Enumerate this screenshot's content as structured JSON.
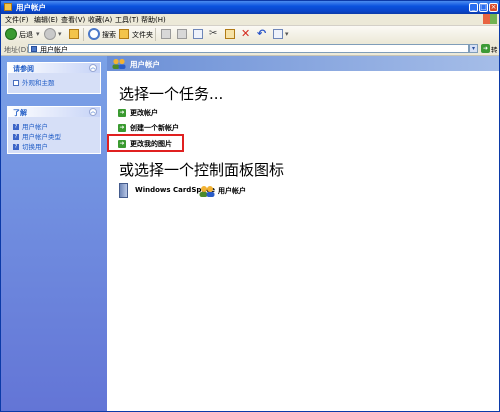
{
  "window": {
    "title": "用户帐户"
  },
  "menu": {
    "items": [
      "文件(F)",
      "编辑(E)",
      "查看(V)",
      "收藏(A)",
      "工具(T)",
      "帮助(H)"
    ]
  },
  "toolbar": {
    "back_label": "后退",
    "search_label": "搜索",
    "folders_label": "文件夹"
  },
  "address": {
    "label": "地址(D)",
    "value": "用户帐户",
    "go_label": "转到"
  },
  "sidebar": {
    "see_also": {
      "header": "请参阅",
      "items": [
        "外观和主题"
      ]
    },
    "learn_about": {
      "header": "了解",
      "items": [
        "用户帐户",
        "用户帐户类型",
        "切换用户"
      ]
    }
  },
  "main": {
    "header_title": "用户帐户",
    "task_heading": "选择一个任务...",
    "tasks": [
      "更改帐户",
      "创建一个新帐户",
      "更改我的图片"
    ],
    "icon_heading": "或选择一个控制面板图标",
    "icons": [
      "Windows CardSpace",
      "用户帐户"
    ]
  },
  "colors": {
    "titlebar": "#0a52de",
    "sidebar": "#6f8ddb",
    "highlight": "#e02020",
    "link": "#215dc6"
  }
}
